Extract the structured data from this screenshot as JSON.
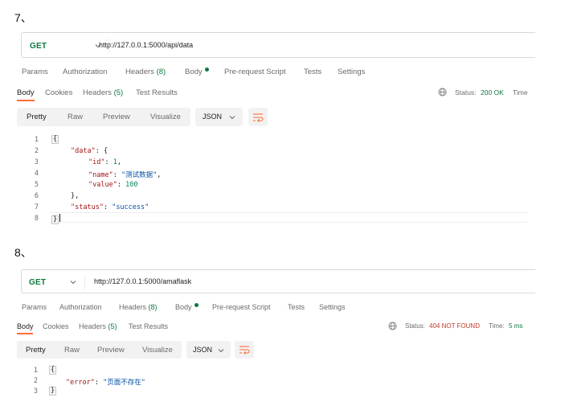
{
  "steps": [
    {
      "number": "7、",
      "request": {
        "method": "GET",
        "url": "http://127.0.0.1:5000/api/data",
        "tabs": [
          "Params",
          "Authorization",
          "Headers",
          "Body",
          "Pre-request Script",
          "Tests",
          "Settings"
        ],
        "headers_count": "(8)"
      },
      "response": {
        "tabs": [
          "Body",
          "Cookies",
          "Headers",
          "Test Results"
        ],
        "headers_count": "(5)",
        "status_label": "Status:",
        "status_value": "200 OK",
        "time_label": "Time",
        "views": [
          "Pretty",
          "Raw",
          "Preview",
          "Visualize"
        ],
        "format": "JSON",
        "line_numbers": [
          "1",
          "2",
          "3",
          "4",
          "5",
          "6",
          "7",
          "8"
        ],
        "code": {
          "open": "{",
          "data_key": "\"data\"",
          "id_key": "\"id\"",
          "id_value": "1",
          "name_key": "\"name\"",
          "name_value": "\"测试数据\"",
          "value_key": "\"value\"",
          "value_value": "100",
          "inner_close": "},",
          "status_key": "\"status\"",
          "status_value": "\"success\"",
          "close": "}"
        }
      }
    },
    {
      "number": "8、",
      "request": {
        "method": "GET",
        "url": "http://127.0.0.1:5000/amaflask",
        "tabs": [
          "Params",
          "Authorization",
          "Headers",
          "Body",
          "Pre-request Script",
          "Tests",
          "Settings"
        ],
        "headers_count": "(8)"
      },
      "response": {
        "tabs": [
          "Body",
          "Cookies",
          "Headers",
          "Test Results"
        ],
        "headers_count": "(5)",
        "status_label": "Status:",
        "status_value": "404 NOT FOUND",
        "time_label": "Time:",
        "time_value": "5 ms",
        "views": [
          "Pretty",
          "Raw",
          "Preview",
          "Visualize"
        ],
        "format": "JSON",
        "line_numbers": [
          "1",
          "2",
          "3"
        ],
        "code": {
          "open": "{",
          "error_key": "\"error\"",
          "error_value": "\"页面不存在\"",
          "close": "}"
        }
      }
    }
  ],
  "colors": {
    "method_get": "#0b7a3e",
    "status_ok": "#0b7a3e",
    "status_error": "#c0392b",
    "accent": "#ff6c37"
  },
  "icons": [
    "chevron-down-icon",
    "globe-icon",
    "wrap-lines-icon"
  ]
}
